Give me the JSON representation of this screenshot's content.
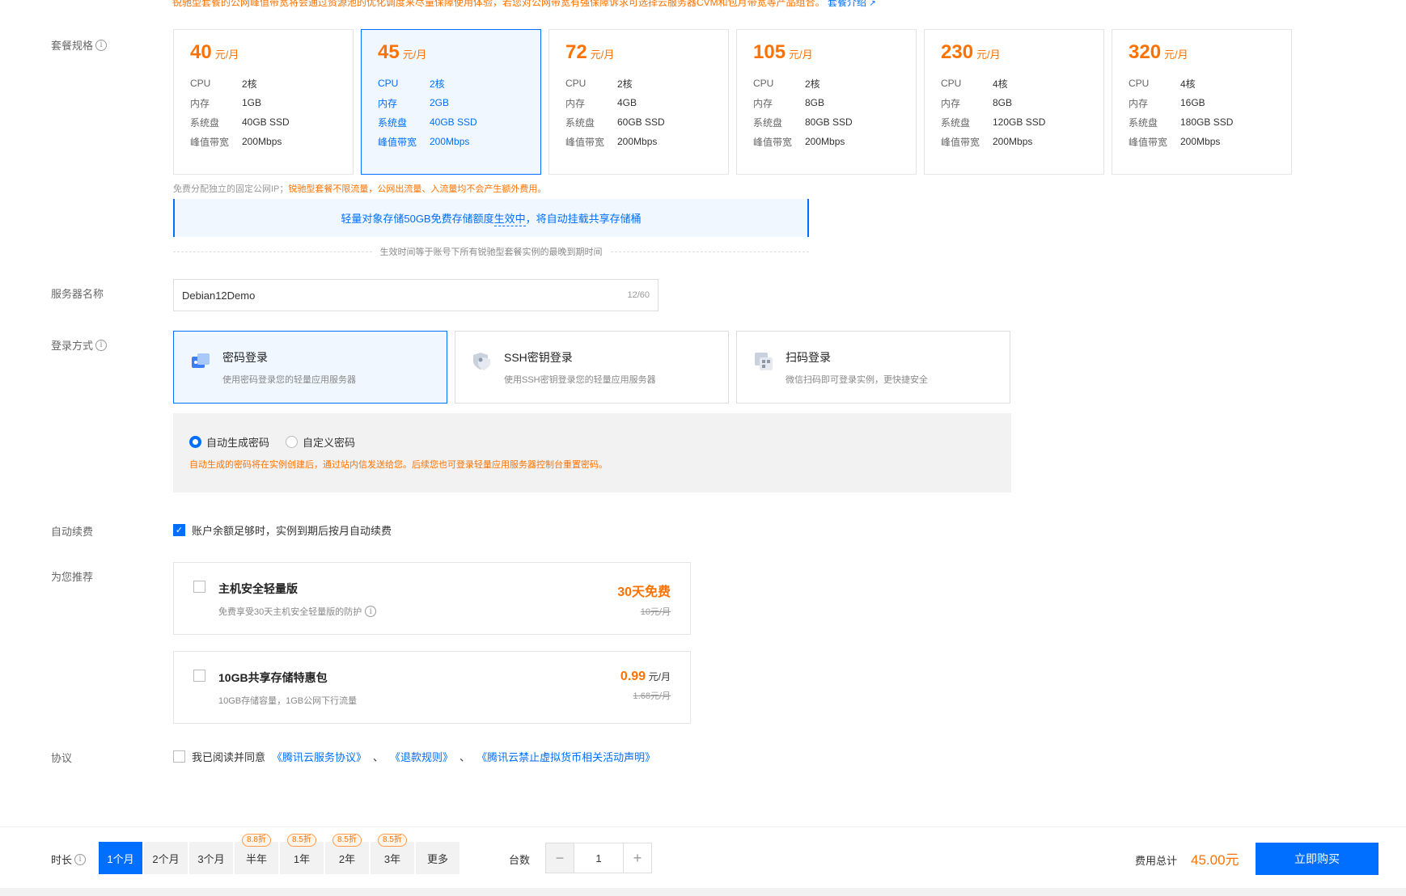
{
  "top_note": {
    "text": "锐驰型套餐的公网峰值带宽将会通过资源池的优化调度来尽量保障使用体验，若您对公网带宽有强保障诉求可选择云服务器CVM和包月带宽等产品组合。",
    "link": "套餐介绍"
  },
  "spec": {
    "label": "套餐规格",
    "plans": [
      {
        "price": "40",
        "unit": "元/月",
        "rows": [
          [
            "CPU",
            "2核"
          ],
          [
            "内存",
            "1GB"
          ],
          [
            "系统盘",
            "40GB SSD"
          ],
          [
            "峰值带宽",
            "200Mbps"
          ]
        ]
      },
      {
        "price": "45",
        "unit": "元/月",
        "rows": [
          [
            "CPU",
            "2核"
          ],
          [
            "内存",
            "2GB"
          ],
          [
            "系统盘",
            "40GB SSD"
          ],
          [
            "峰值带宽",
            "200Mbps"
          ]
        ]
      },
      {
        "price": "72",
        "unit": "元/月",
        "rows": [
          [
            "CPU",
            "2核"
          ],
          [
            "内存",
            "4GB"
          ],
          [
            "系统盘",
            "60GB SSD"
          ],
          [
            "峰值带宽",
            "200Mbps"
          ]
        ]
      },
      {
        "price": "105",
        "unit": "元/月",
        "rows": [
          [
            "CPU",
            "2核"
          ],
          [
            "内存",
            "8GB"
          ],
          [
            "系统盘",
            "80GB SSD"
          ],
          [
            "峰值带宽",
            "200Mbps"
          ]
        ]
      },
      {
        "price": "230",
        "unit": "元/月",
        "rows": [
          [
            "CPU",
            "4核"
          ],
          [
            "内存",
            "8GB"
          ],
          [
            "系统盘",
            "120GB SSD"
          ],
          [
            "峰值带宽",
            "200Mbps"
          ]
        ]
      },
      {
        "price": "320",
        "unit": "元/月",
        "rows": [
          [
            "CPU",
            "4核"
          ],
          [
            "内存",
            "16GB"
          ],
          [
            "系统盘",
            "180GB SSD"
          ],
          [
            "峰值带宽",
            "200Mbps"
          ]
        ]
      }
    ],
    "free_ip_gray": "免费分配独立的固定公网IP；",
    "free_ip_orange": "锐驰型套餐不限流量，公网出流量、入流量均不会产生额外费用。",
    "storage_banner_pre": "轻量对象存储50GB免费存储额度",
    "storage_banner_link": "生效中",
    "storage_banner_post": "，将自动挂载共享存储桶",
    "effect_note": "生效时间等于账号下所有锐驰型套餐实例的最晚到期时间"
  },
  "server_name": {
    "label": "服务器名称",
    "value": "Debian12Demo",
    "count": "12/60"
  },
  "login": {
    "label": "登录方式",
    "options": [
      {
        "title": "密码登录",
        "desc": "使用密码登录您的轻量应用服务器"
      },
      {
        "title": "SSH密钥登录",
        "desc": "使用SSH密钥登录您的轻量应用服务器"
      },
      {
        "title": "扫码登录",
        "desc": "微信扫码即可登录实例，更快捷安全"
      }
    ],
    "radio_auto": "自动生成密码",
    "radio_custom": "自定义密码",
    "note": "自动生成的密码将在实例创建后，通过站内信发送给您。后续您也可登录轻量应用服务器控制台重置密码。"
  },
  "renew": {
    "label": "自动续费",
    "text": "账户余额足够时，实例到期后按月自动续费"
  },
  "recommend": {
    "label": "为您推荐",
    "items": [
      {
        "title": "主机安全轻量版",
        "desc": "免费享受30天主机安全轻量版的防护",
        "price": "30天免费",
        "unit": "",
        "old": "10元/月"
      },
      {
        "title": "10GB共享存储特惠包",
        "desc": "10GB存储容量，1GB公网下行流量",
        "price": "0.99",
        "unit": "元/月",
        "old": "1.68元/月"
      }
    ]
  },
  "agreement": {
    "label": "协议",
    "pre": "我已阅读并同意",
    "link1": "《腾讯云服务协议》",
    "sep1": "、",
    "link2": "《退款规则》",
    "sep2": "、",
    "link3": "《腾讯云禁止虚拟货币相关活动声明》"
  },
  "footer": {
    "duration_label": "时长",
    "durations": [
      {
        "label": "1个月",
        "badge": ""
      },
      {
        "label": "2个月",
        "badge": ""
      },
      {
        "label": "3个月",
        "badge": ""
      },
      {
        "label": "半年",
        "badge": "8.8折"
      },
      {
        "label": "1年",
        "badge": "8.5折"
      },
      {
        "label": "2年",
        "badge": "8.5折"
      },
      {
        "label": "3年",
        "badge": "8.5折"
      },
      {
        "label": "更多",
        "badge": ""
      }
    ],
    "qty_label": "台数",
    "minus": "−",
    "qty": "1",
    "plus": "+",
    "total_label": "费用总计",
    "total": "45.00元",
    "buy": "立即购买"
  },
  "colors": {
    "primary": "#006eff",
    "accent": "#ff7200"
  }
}
